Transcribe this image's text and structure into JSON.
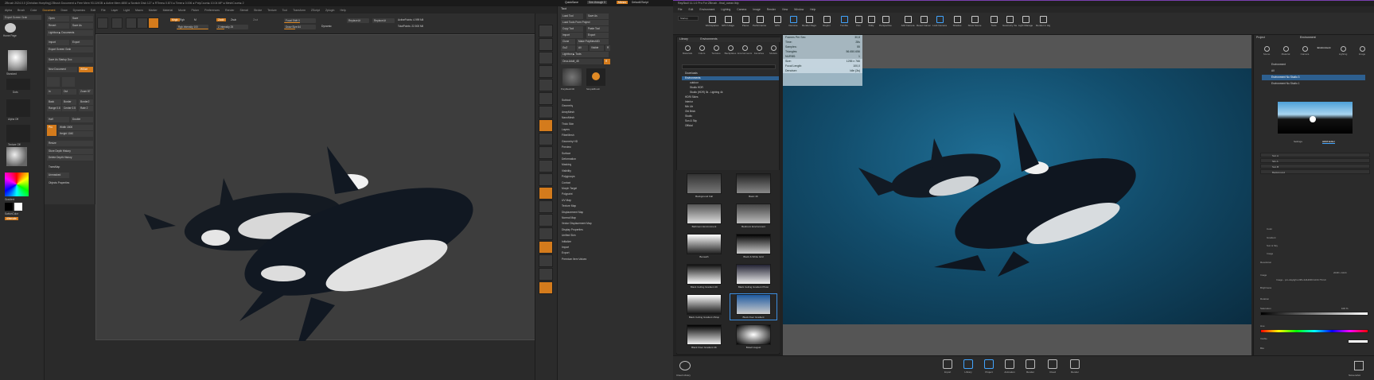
{
  "zbrush": {
    "title": "ZBrush 2024.0.0 [Christian Hoepfing]  ZBrush Document  ● Free Mem 93.119GB ● Active Mem 4850 ● Scratch Disk 127 ● RTime● 0.874 ● Timer● 0.006 ● PolyCount● 10.04 MP ● MeshCount● 2",
    "menu": [
      "Alpha",
      "Brush",
      "Color",
      "Document",
      "Draw",
      "Dynamics",
      "Edit",
      "File",
      "Layer",
      "Light",
      "Macro",
      "Marker",
      "Material",
      "Movie",
      "Picker",
      "Preferences",
      "Render",
      "Stencil",
      "Stroke",
      "Texture",
      "Tool",
      "Transform",
      "ZScript",
      "Zplugin",
      "Help"
    ],
    "menu_active": "Document",
    "quicksave": "QuickSave",
    "see_through": "See-through 0",
    "menus_label": "Menus",
    "default_script": "DefaultZScript",
    "shelf": {
      "edit": "Edit",
      "draw": "Draw",
      "move": "Move",
      "scale": "Scale",
      "rotate": "Rotate",
      "mrgb": "Mrgb",
      "rgb": "Rgb",
      "m": "M",
      "zadd": "Zadd",
      "zsub": "Zsub",
      "zcut": "Zcut",
      "focal_shift": "Focal Shift 0",
      "draw_size": "Draw Size 64",
      "z_intensity": "Z Intensity 25",
      "rgb_intensity": "Rgb Intensity 100",
      "dynamic": "Dynamic",
      "replace_lit": "ReplaceLit",
      "replace_lit2": "ReplaceLit",
      "active_points": "ActivePoints: 4.999 Mil",
      "total_points": "TotalPoints: 22.500 Mil"
    },
    "left": {
      "export_screen": "Export Screen Grab",
      "home_page": "Home Page",
      "lightbox": "LightBox",
      "live_boolean": "Live Boolean",
      "standard": "Standard",
      "dots": "Dots",
      "alpha_off": "Alpha Off",
      "texture_off": "Texture Off",
      "basicmat": "BasicMaterial",
      "gradient": "Gradient",
      "switch_color": "SwitchColor",
      "alternate": "Alternate"
    },
    "palette": {
      "open": "Open",
      "save": "Save",
      "save_as": "Save As",
      "revert": "Revert",
      "lightbox_doc": "Lightbox ▶ Documents",
      "import": "Import",
      "export": "Export",
      "export_grab": "Export Screen Grab",
      "save_startup": "Save As Startup Doc",
      "wsize": "WSize",
      "new_document": "New Document",
      "crop": "Crop",
      "zapp_link": "ZAppLink Properties",
      "in": "In",
      "out": "Out",
      "zoom": "Zoom 87",
      "back": "Back",
      "border": "Border",
      "border2": "Border2",
      "range": "Range 0.6",
      "center": "Center 0.5",
      "rate": "Rate 2",
      "half": "Half",
      "double": "Double",
      "pro": "Pro",
      "width": "Width 1800",
      "height": "Height 1040",
      "resize": "Resize",
      "store_depth": "Store Depth History",
      "delete_depth": "Delete Depth History",
      "transp": "TransMap",
      "unmasked": "Unmasked",
      "objprop": "Objects Properties"
    },
    "tool": {
      "load_tool": "Load Tool",
      "save_as": "Save As",
      "load_tools_from_project": "Load Tools From Project",
      "copy_tool": "Copy Tool",
      "paste_tool": "Paste Tool",
      "import": "Import",
      "export": "Export",
      "clone": "Clone",
      "make_polymesh": "Make PolyMesh3D",
      "goz": "GoZ",
      "all": "All",
      "visible": "Visible",
      "r": "R",
      "lightbox_tools": "Lightbox ▶ Tools",
      "orca_label": "Orca-Adult_48",
      "r_label": "R",
      "items": [
        "Subtool",
        "Geometry",
        "ArrayMesh",
        "NanoMesh",
        "Thick Skin",
        "Layers",
        "FiberMesh",
        "Geometry HD",
        "Preview",
        "Surface",
        "Deformation",
        "Masking",
        "Visibility",
        "Polygroups",
        "Contact",
        "Morph Target",
        "Polypaint",
        "UV Map",
        "Texture Map",
        "Displacement Map",
        "Normal Map",
        "Vector Displacement Map",
        "Display Properties",
        "Unified Skin",
        "Initialize",
        "Import",
        "Export",
        "Premium Item Values"
      ],
      "simple_brush": "SimpleBrush",
      "polymesh": "PolyMesh3D"
    },
    "strip": [
      "BPR",
      "SPix 3",
      "Scroll",
      "Zoom",
      "Actual",
      "AAHalf",
      "Persp",
      "Floor",
      "Local",
      "LSym",
      "Gxyz",
      "Frame",
      "Move",
      "Scale",
      "Rotate",
      "Line Fill PolyF",
      "Transp",
      "Ghost",
      "Solo",
      "Xpose"
    ]
  },
  "octane": {
    "title": "RaySkull 11.1.0 Pro For ZBrush - final_ocean.lblp",
    "menu": [
      "File",
      "Edit",
      "Environment",
      "Lighting",
      "Camera",
      "Image",
      "Render",
      "View",
      "Window",
      "Help"
    ],
    "toolbar": [
      {
        "id": "workspaces",
        "label": "Workspaces"
      },
      {
        "id": "cpu",
        "label": "GPU Usage"
      },
      {
        "id": "pause",
        "label": "Pause"
      },
      {
        "id": "perf",
        "label": "Performance Settings"
      },
      {
        "id": "gpu",
        "label": "GPU"
      },
      {
        "id": "denoise",
        "label": "Denoise"
      },
      {
        "id": "render_region",
        "label": "Render Region"
      },
      {
        "id": "region",
        "label": "Region"
      },
      {
        "id": "tumble",
        "label": "Tumble"
      },
      {
        "id": "pan",
        "label": "Pan"
      },
      {
        "id": "dolly",
        "label": "Dolly"
      },
      {
        "id": "perspective",
        "label": "Perspective"
      },
      {
        "id": "add_camera",
        "label": "Add Camera"
      },
      {
        "id": "reset_camera",
        "label": "Reset Camera"
      },
      {
        "id": "lock_camera",
        "label": "Lock Camera"
      },
      {
        "id": "shadow",
        "label": "Shadow"
      },
      {
        "id": "show_scene",
        "label": "Show Scene"
      },
      {
        "id": "tools",
        "label": "Tools"
      },
      {
        "id": "geometry_view",
        "label": "Geometry View"
      },
      {
        "id": "light_manager",
        "label": "Light Manager"
      },
      {
        "id": "render_high_dpi",
        "label": "Render in High DPI"
      }
    ],
    "toolbar_startup": "Startup",
    "library": {
      "title": "Library",
      "subtitle": "Environments",
      "tabs": [
        "Materials",
        "Colors",
        "Textures",
        "Backplates",
        "Environments",
        "Favorites",
        "Models"
      ],
      "tree": [
        "Downloads",
        "Environments",
        "outdoor",
        "Studio HDR",
        "Studio (HDR) 3k - Lighting 4k",
        "HDRI Skies",
        "Interior",
        "Mix Lib",
        "Old Brick",
        "Studio",
        "Sun & Sky",
        "Official"
      ],
      "thumbs": [
        "Background Fall",
        "Basic 4K",
        "Bathroom Environment",
        "Bedroom Environment",
        "Beneath",
        "Black & White Grid",
        "Black Ceiling Gradient 4K",
        "Black Ceiling Gradient Photo",
        "Black Ceiling Gradient 2Stop",
        "Black Door Gradient",
        "Black Floor Gradient 4K",
        "Bokeh August"
      ]
    },
    "stats": [
      [
        "Frames Per Sec:",
        "30,8"
      ],
      [
        "Time:",
        "28s"
      ],
      [
        "Samples:",
        "55"
      ],
      [
        "Triangles:",
        "56.650.656"
      ],
      [
        "NURBS:",
        "1"
      ],
      [
        "Size:",
        "1255 x 766"
      ],
      [
        "Focal Length:",
        "100,0"
      ],
      [
        "Denoiser:",
        "Idle (3s)"
      ]
    ],
    "project": {
      "title": "Project",
      "tab_title": "Environment",
      "tabs": [
        "Scene",
        "Material",
        "Camera",
        "Environment",
        "Lighting",
        "Image"
      ],
      "items": [
        "Environment",
        "All",
        "Environment No Studio 3",
        "Environment No Studio 1"
      ],
      "selected": 2,
      "settings": "Settings",
      "hdri_editor": "HDRI Editor",
      "layers": [
        "Sun A",
        "Sky A",
        "Sun B",
        "Background"
      ],
      "props": [
        "Color",
        "Gradient",
        "Sun & Sky",
        "Image",
        "Resolution",
        "Image",
        "Brightness",
        "Rotation",
        "Saturation",
        "Hue",
        "Visible",
        "Blur"
      ],
      "resolution_value": "2048 x 1024",
      "image_value": "Image - pro-daylight-cliffs-fullHDRI.hdr/0.75.hdr",
      "saturation_value": "100 %"
    },
    "bottom": [
      {
        "id": "import",
        "label": "Import"
      },
      {
        "id": "library",
        "label": "Library"
      },
      {
        "id": "project",
        "label": "Project"
      },
      {
        "id": "animation",
        "label": "Animation"
      },
      {
        "id": "render",
        "label": "Render"
      },
      {
        "id": "cloud",
        "label": "Cloud"
      },
      {
        "id": "keyshot",
        "label": "Render"
      }
    ],
    "bottom_left": "Cloud Library",
    "bottom_right": "Screenshot"
  },
  "colors": {
    "accent": "#e08a25",
    "blue_sel": "#2d5f8f",
    "octane_purple": "#7a3fb0"
  }
}
